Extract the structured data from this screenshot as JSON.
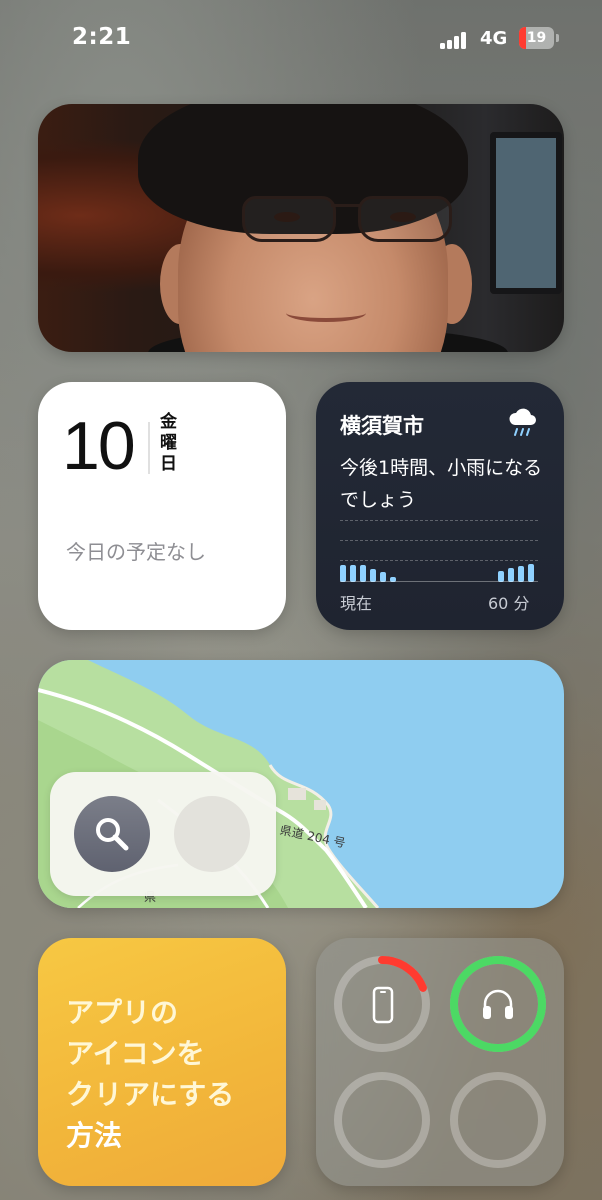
{
  "status_bar": {
    "time": "2:21",
    "network": "4G",
    "battery_level": "19",
    "battery_fraction": 0.19,
    "battery_color": "#ff3b30",
    "signal_bars": 4
  },
  "photo_widget": {
    "subject": "portrait photo of a man with glasses"
  },
  "calendar_widget": {
    "day": "10",
    "weekday": [
      "金",
      "曜",
      "日"
    ],
    "empty_message": "今日の予定なし"
  },
  "weather_widget": {
    "city": "横須賀市",
    "icon": "rain-cloud-icon",
    "message": "今後1時間、小雨になるでしょう",
    "start_label": "現在",
    "end_label": "60 分",
    "precip_intensity": [
      0.7,
      0.7,
      0.7,
      0.55,
      0.4,
      0.2,
      0,
      0,
      0,
      0,
      0,
      0,
      0,
      0,
      0,
      0,
      0.45,
      0.6,
      0.65,
      0.75
    ],
    "bar_color": "#8fd1ff"
  },
  "map_widget": {
    "road_label": "県道 204 号",
    "road_label_partial": "県",
    "search_icon": "search-icon"
  },
  "tips_widget": {
    "lines": [
      "アプリの",
      "アイコンを",
      "クリアにする",
      "方法"
    ]
  },
  "batteries_widget": {
    "devices": [
      {
        "name": "phone",
        "icon": "phone-icon",
        "level": 0.19,
        "color": "#ff3b30"
      },
      {
        "name": "headphones",
        "icon": "headphones-icon",
        "level": 1.0,
        "color": "#4cd964"
      },
      {
        "name": "empty-slot-1",
        "icon": "",
        "level": 0,
        "color": ""
      },
      {
        "name": "empty-slot-2",
        "icon": "",
        "level": 0,
        "color": ""
      }
    ]
  }
}
